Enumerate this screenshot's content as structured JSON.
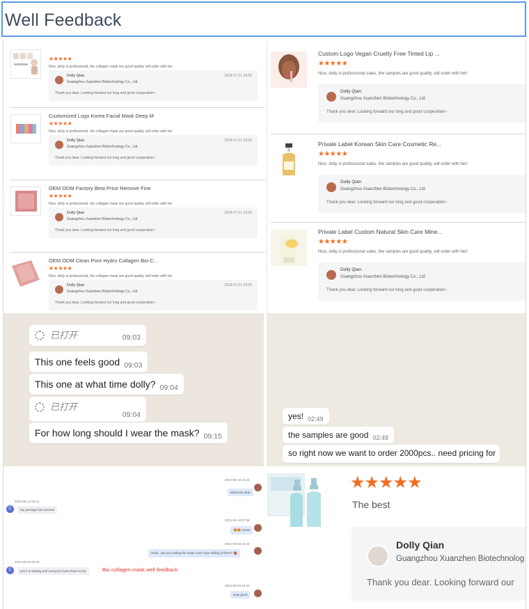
{
  "title": "Well Feedback",
  "colors": {
    "accent_border": "#5b9be0",
    "star": "#f26d21"
  },
  "left_reviews": [
    {
      "title": "",
      "stars": "★★★★★",
      "text": "Nice, dolly is professional, the collagen mask are good quality, will order with her",
      "reply_name": "Dolly Qian",
      "reply_company": "Guangzhou Xuanzhen Biotechnology Co., Ltd",
      "reply_date": "2024-07-31 23:09",
      "reply_text": "Thank you dear. Looking forward our long and good cooperation~"
    },
    {
      "title": "Customized Logo Korea Facial Mask Deep M",
      "stars": "★★★★★",
      "text": "Nice, dolly is professional, the collagen mask are good quality, will order with her",
      "reply_name": "Dolly Qian",
      "reply_company": "Guangzhou Xuanzhen Biotechnology Co., Ltd",
      "reply_date": "2024-07-31 23:09",
      "reply_text": "Thank you dear. Looking forward our long and good cooperation~"
    },
    {
      "title": "OEM ODM Factory Best Price Remove Fine",
      "stars": "★★★★★",
      "text": "Nice, dolly is professional, the collagen mask are good quality, will order with her",
      "reply_name": "Dolly Qian",
      "reply_company": "Guangzhou Xuanzhen Biotechnology Co., Ltd",
      "reply_date": "2024-07-31 23:09",
      "reply_text": "Thank you dear. Looking forward our long and good cooperation~"
    },
    {
      "title": "OEM ODM Clean Pore Hydro Collagen Bio-C...",
      "stars": "★★★★★",
      "text": "Nice, dolly is professional, the collagen mask are good quality, will order with her",
      "reply_name": "Dolly Qian",
      "reply_company": "Guangzhou Xuanzhen Biotechnology Co., Ltd",
      "reply_date": "2024-07-31 23:09",
      "reply_text": "Thank you dear. Looking forward our long and good cooperation~"
    }
  ],
  "right_reviews": [
    {
      "title": "Custom Logo Vegan Cruelty Free Tinted Lip ...",
      "stars": "★★★★★",
      "text": "Nice, dolly is professional sales, the samples are good quality, will order with her!",
      "reply_name": "Dolly Qian",
      "reply_company": "Guangzhou Xuanzhen Biotechnology Co., Ltd",
      "reply_text": "Thank you dear. Looking forward our long and good cooperation~"
    },
    {
      "title": "Private Label Korean Skin Care Cosmetic Re...",
      "stars": "★★★★★",
      "text": "Nice, dolly is professional sales, the samples are good quality, will order with her!",
      "reply_name": "Dolly Qian",
      "reply_company": "Guangzhou Xuanzhen Biotechnology Co., Ltd",
      "reply_text": "Thank you dear. Looking forward our long and good cooperation~"
    },
    {
      "title": "Private Label Custom Natural Skin Care Mine...",
      "stars": "★★★★★",
      "text": "Nice, dolly is professional sales, the samples are good quality, will order with her!",
      "reply_name": "Dolly Qian",
      "reply_company": "Guangzhou Xuanzhen Biotechnology Co., Ltd",
      "reply_text": "Thank you dear. Looking forward our long and good cooperation~"
    }
  ],
  "chat_left": [
    {
      "kind": "opened",
      "text": "已打开",
      "time": "09:03"
    },
    {
      "kind": "msg",
      "text": "This one feels good",
      "time": "09:03"
    },
    {
      "kind": "msg",
      "text": "This one at what time dolly?",
      "time": "09:04"
    },
    {
      "kind": "opened",
      "text": "已打开",
      "time": "09:04"
    },
    {
      "kind": "msg",
      "text": "For how long should I wear the mask?",
      "time": "09:15"
    }
  ],
  "chat_right": [
    {
      "text": "yes!",
      "time": "02:49"
    },
    {
      "text": "the samples are good",
      "time": "02:49"
    },
    {
      "text": "so right now we want to order 2000pcs.. need pricing for",
      "time": ""
    }
  ],
  "bottom_chat": {
    "d1": "2024-08-12 16:48",
    "m1": "Welcome dear",
    "d2": "2024-08-14 03:31",
    "m2": "My package has arrived!",
    "d3": "2024-08-14 07:38",
    "m3": "🤩🤩 Great",
    "d4": "2024-09-03 15:49",
    "m4": "Hello , are you selling the mask now? how selling of them? 🍓",
    "d5": "2024-09-03 06:26",
    "m5": "yes it is seeling and everyone loves them so far",
    "caption": "Bio collagen mask well feedback",
    "d6": "2024-09-03 16:40",
    "m6": "wow good",
    "avatar_letter": "C"
  },
  "bottom_review": {
    "stars": "★★★★★",
    "text": "The best",
    "reply_name": "Dolly Qian",
    "reply_company": "Guangzhou Xuanzhen Biotechnolog",
    "reply_text": "Thank you dear. Looking forward our"
  }
}
